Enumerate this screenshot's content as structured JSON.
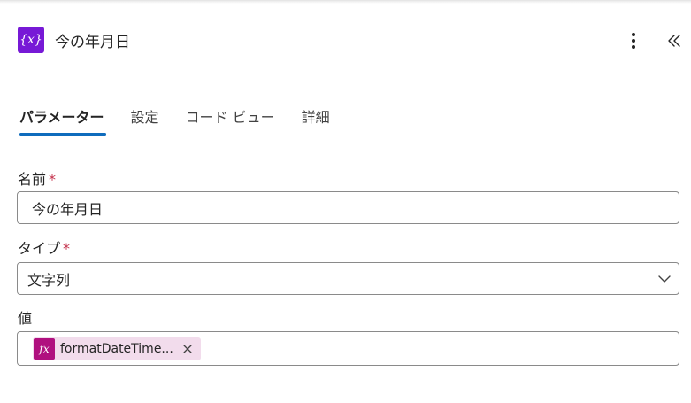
{
  "header": {
    "icon_glyph": "{x}",
    "icon": "variable-icon",
    "title": "今の年月日",
    "accent": "#7719d6"
  },
  "tabs": [
    {
      "label": "パラメーター",
      "active": true
    },
    {
      "label": "設定",
      "active": false
    },
    {
      "label": "コード ビュー",
      "active": false
    },
    {
      "label": "詳細",
      "active": false
    }
  ],
  "tab_indicator_color": "#0f6cbd",
  "fields": {
    "name": {
      "label": "名前",
      "required_mark": "*",
      "value": "今の年月日"
    },
    "type": {
      "label": "タイプ",
      "required_mark": "*",
      "value": "文字列"
    },
    "value": {
      "label": "値",
      "token": {
        "icon_glyph": "fx",
        "text": "formatDateTime...",
        "color": "#b0107f"
      }
    }
  }
}
